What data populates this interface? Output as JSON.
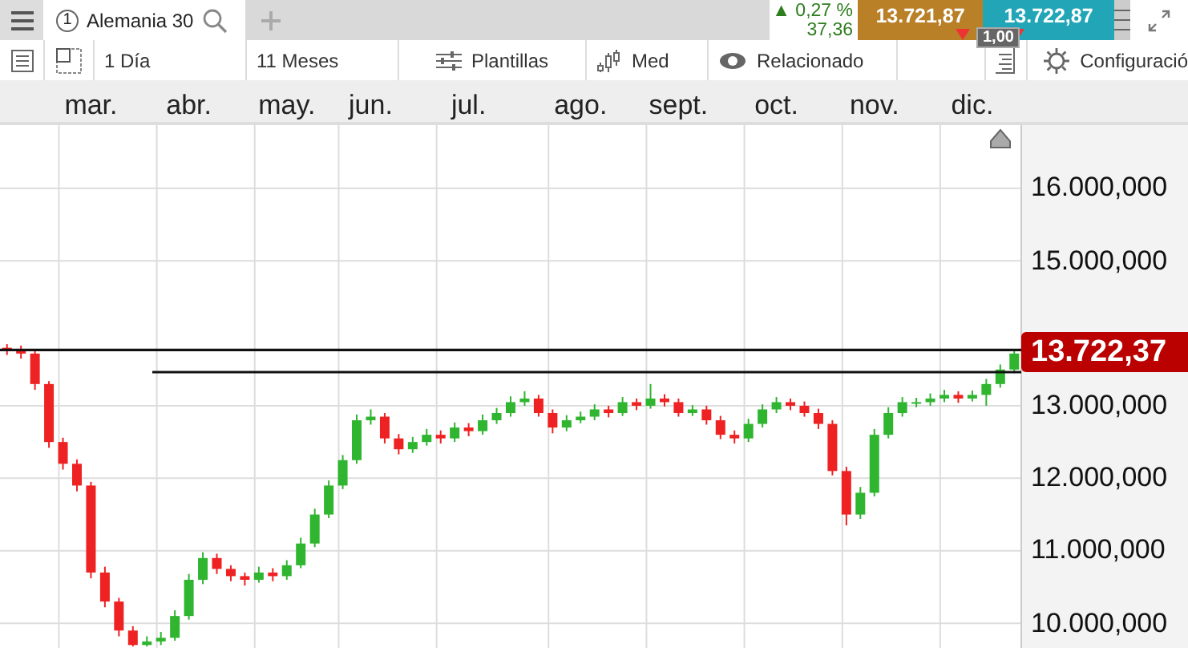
{
  "tabs": [
    {
      "number": "1",
      "label": "Alemania 30",
      "selected": true
    }
  ],
  "quote": {
    "change": "▲ 0,27 %",
    "change_points": "37,36",
    "sell": "13.721,87",
    "buy": "13.722,87",
    "spread": "1,00"
  },
  "toolbar": [
    {
      "kind": "list"
    },
    {
      "kind": "grid"
    },
    {
      "kind": "text",
      "label": "1 Día"
    },
    {
      "kind": "text",
      "label": "11 Meses"
    },
    {
      "kind": "templates",
      "label": "Plantillas"
    },
    {
      "kind": "candles",
      "label": "Med"
    },
    {
      "kind": "eye",
      "label": "Relacionado"
    }
  ],
  "settings": "Configuració",
  "chart_data": {
    "type": "candlestick",
    "ylim": [
      9659,
      16827
    ],
    "grid": true,
    "ref_lines": [
      {
        "axis": "y",
        "value": 13770
      },
      {
        "axis": "y",
        "value": 13464
      }
    ],
    "categories": [
      null,
      null,
      null,
      null,
      null,
      null,
      "mar.",
      null,
      null,
      null,
      null,
      null,
      null,
      "abr.",
      null,
      null,
      null,
      null,
      null,
      null,
      "may.",
      null,
      null,
      null,
      null,
      null,
      "jun.",
      null,
      null,
      null,
      null,
      null,
      null,
      "jul.",
      null,
      null,
      null,
      null,
      null,
      null,
      null,
      "ago.",
      null,
      null,
      null,
      null,
      null,
      null,
      "sept.",
      null,
      null,
      null,
      null,
      null,
      null,
      "oct.",
      null,
      null,
      null,
      null,
      null,
      null,
      "nov.",
      null,
      null,
      null,
      null,
      null,
      null,
      "dic.",
      null,
      null,
      null
    ],
    "yticks": [
      {
        "value": 16000,
        "label": "16.000,000"
      },
      {
        "value": 15000,
        "label": "15.000,000"
      },
      {
        "value": 13000,
        "label": "13.000,000"
      },
      {
        "value": 12000,
        "label": "12.000,000"
      },
      {
        "value": 11000,
        "label": "11.000,000"
      },
      {
        "value": 10000,
        "label": "10.000,000"
      }
    ],
    "ohlc": [
      [
        13800,
        13850,
        13700,
        13760
      ],
      [
        13760,
        13830,
        13650,
        13720
      ],
      [
        13720,
        13760,
        13220,
        13300
      ],
      [
        13300,
        13340,
        12420,
        12500
      ],
      [
        12500,
        12560,
        12120,
        12200
      ],
      [
        12200,
        12260,
        11820,
        11900
      ],
      [
        11900,
        11950,
        10620,
        10700
      ],
      [
        10700,
        10780,
        10220,
        10300
      ],
      [
        10300,
        10350,
        9820,
        9900
      ],
      [
        9900,
        9960,
        9680,
        9700
      ],
      [
        9700,
        9820,
        9680,
        9750
      ],
      [
        9750,
        9880,
        9700,
        9800
      ],
      [
        9800,
        10180,
        9760,
        10100
      ],
      [
        10100,
        10680,
        10050,
        10600
      ],
      [
        10600,
        10980,
        10540,
        10900
      ],
      [
        10900,
        10960,
        10680,
        10750
      ],
      [
        10750,
        10800,
        10580,
        10650
      ],
      [
        10650,
        10700,
        10520,
        10600
      ],
      [
        10600,
        10780,
        10560,
        10700
      ],
      [
        10700,
        10760,
        10580,
        10650
      ],
      [
        10650,
        10870,
        10600,
        10800
      ],
      [
        10800,
        11180,
        10760,
        11100
      ],
      [
        11100,
        11580,
        11050,
        11500
      ],
      [
        11500,
        11970,
        11450,
        11900
      ],
      [
        11900,
        12320,
        11850,
        12250
      ],
      [
        12250,
        12880,
        12200,
        12800
      ],
      [
        12800,
        12950,
        12740,
        12850
      ],
      [
        12850,
        12900,
        12480,
        12550
      ],
      [
        12550,
        12610,
        12330,
        12400
      ],
      [
        12400,
        12570,
        12350,
        12500
      ],
      [
        12500,
        12680,
        12450,
        12600
      ],
      [
        12600,
        12660,
        12480,
        12550
      ],
      [
        12550,
        12770,
        12500,
        12700
      ],
      [
        12700,
        12760,
        12580,
        12650
      ],
      [
        12650,
        12880,
        12600,
        12800
      ],
      [
        12800,
        12970,
        12750,
        12900
      ],
      [
        12900,
        13130,
        12850,
        13050
      ],
      [
        13050,
        13200,
        13000,
        13100
      ],
      [
        13100,
        13150,
        12850,
        12900
      ],
      [
        12900,
        12950,
        12620,
        12700
      ],
      [
        12700,
        12870,
        12650,
        12800
      ],
      [
        12800,
        12920,
        12760,
        12850
      ],
      [
        12850,
        13020,
        12800,
        12950
      ],
      [
        12950,
        13000,
        12840,
        12900
      ],
      [
        12900,
        13120,
        12860,
        13050
      ],
      [
        13050,
        13100,
        12940,
        13000
      ],
      [
        13000,
        13300,
        12960,
        13100
      ],
      [
        13100,
        13160,
        12990,
        13050
      ],
      [
        13050,
        13100,
        12850,
        12900
      ],
      [
        12900,
        13010,
        12860,
        12950
      ],
      [
        12950,
        13000,
        12740,
        12800
      ],
      [
        12800,
        12860,
        12540,
        12600
      ],
      [
        12600,
        12660,
        12480,
        12550
      ],
      [
        12550,
        12820,
        12500,
        12750
      ],
      [
        12750,
        13020,
        12700,
        12950
      ],
      [
        12950,
        13120,
        12900,
        13050
      ],
      [
        13050,
        13100,
        12940,
        13000
      ],
      [
        13000,
        13060,
        12850,
        12900
      ],
      [
        12900,
        12960,
        12680,
        12750
      ],
      [
        12750,
        12800,
        12040,
        12100
      ],
      [
        12100,
        12160,
        11350,
        11500
      ],
      [
        11500,
        11880,
        11440,
        11800
      ],
      [
        11800,
        12680,
        11750,
        12600
      ],
      [
        12600,
        12980,
        12550,
        12900
      ],
      [
        12900,
        13120,
        12850,
        13050
      ],
      [
        13050,
        13110,
        12980,
        13050
      ],
      [
        13050,
        13170,
        13000,
        13100
      ],
      [
        13100,
        13220,
        13050,
        13150
      ],
      [
        13150,
        13200,
        13040,
        13100
      ],
      [
        13100,
        13210,
        13060,
        13150
      ],
      [
        13150,
        13370,
        13000,
        13300
      ],
      [
        13300,
        13570,
        13250,
        13500
      ],
      [
        13500,
        13780,
        13450,
        13720
      ]
    ]
  },
  "current_price": "13.722,37"
}
